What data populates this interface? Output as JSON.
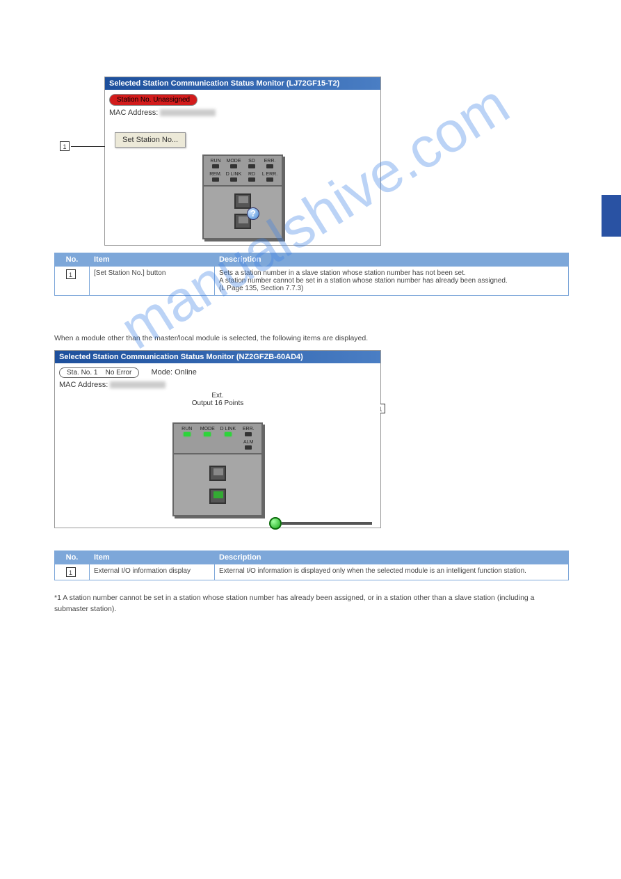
{
  "watermark": "manualshive.com",
  "panel1": {
    "title": "Selected Station Communication Status Monitor (LJ72GF15-T2)",
    "badge_label": "Station No. Unassigned",
    "mac_label": "MAC Address:",
    "set_button": "Set Station No...",
    "leds_row1": [
      "RUN",
      "MODE",
      "SD",
      "ERR."
    ],
    "leds_row2": [
      "REM.",
      "D LINK",
      "RD",
      "L ERR."
    ],
    "q_glyph": "?"
  },
  "table1": {
    "headers": [
      "No.",
      "Item",
      "Description"
    ],
    "rows": [
      {
        "no": "1",
        "item": "[Set Station No.] button",
        "desc_line1": "Sets a station number in a slave station whose station number has not been set.",
        "desc_line2": "A station number cannot be set in a station whose station number has already been assigned.",
        "desc_link": "(L Page 135, Section 7.7.3)"
      }
    ]
  },
  "panel2": {
    "intro": "When a module other than the master/local module is selected, the following items are displayed.",
    "title": "Selected Station Communication Status Monitor (NZ2GFZB-60AD4)",
    "sta_label": "Sta. No. 1",
    "err_label": "No Error",
    "mode_label": "Mode:",
    "mode_value": "Online",
    "mac_label": "MAC Address:",
    "ext_label": "Ext.",
    "ext_value": "Output 16 Points",
    "leds_row1": [
      "RUN",
      "MODE",
      "D LINK",
      "ERR."
    ],
    "alm_label": "ALM"
  },
  "table2": {
    "headers": [
      "No.",
      "Item",
      "Description"
    ],
    "rows": [
      {
        "no": "1",
        "item": "External I/O information display",
        "desc": "External I/O information is displayed only when the selected module is an intelligent function station."
      }
    ]
  },
  "footnote": "*1 A station number cannot be set in a station whose station number has already been assigned, or in a station other than a slave station (including a submaster station)."
}
